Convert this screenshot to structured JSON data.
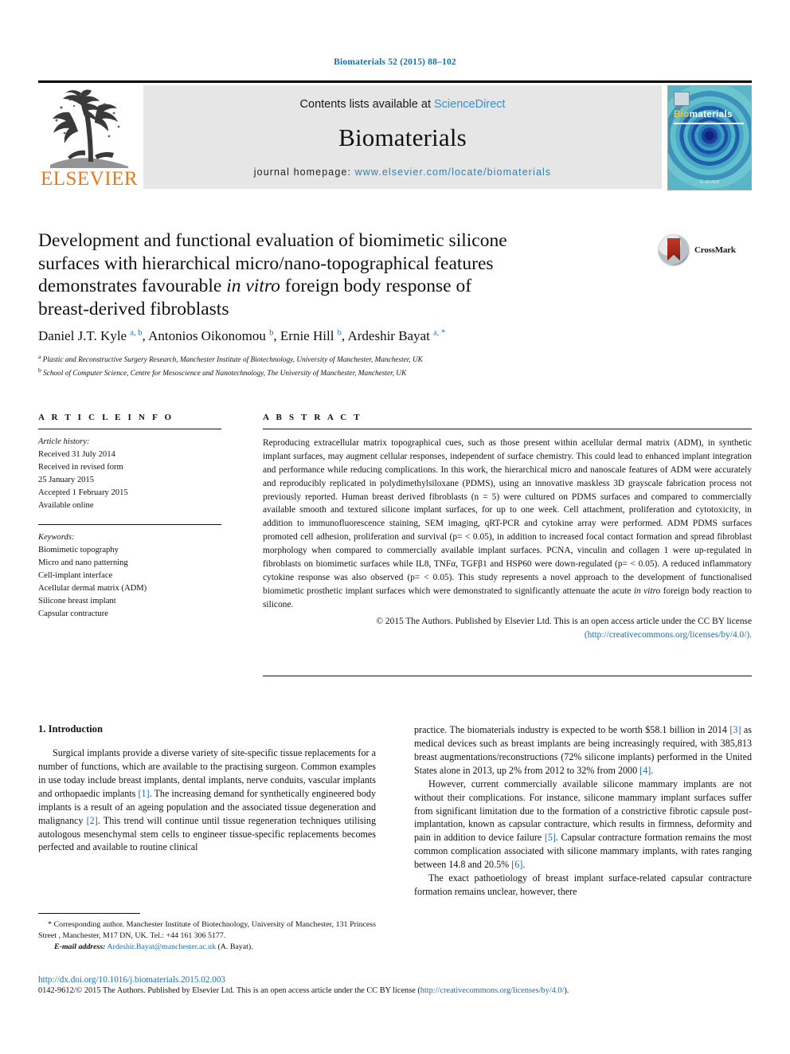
{
  "running_head": "Biomaterials 52 (2015) 88–102",
  "masthead": {
    "publisher_name": "ELSEVIER",
    "contents_prefix": "Contents lists available at ",
    "contents_link": "ScienceDirect",
    "journal_title": "Biomaterials",
    "homepage_prefix": "journal homepage: ",
    "homepage_url": "www.elsevier.com/locate/biomaterials",
    "cover": {
      "title_first": "Bio",
      "title_rest": "materials",
      "footer": "ELSEVIER"
    }
  },
  "article": {
    "title_line1": "Development and functional evaluation of biomimetic silicone",
    "title_line2": "surfaces with hierarchical micro/nano-topographical features",
    "title_line3_pre": "demonstrates favourable ",
    "title_line3_em": "in vitro",
    "title_line3_post": " foreign body response of",
    "title_line4": "breast-derived fibroblasts",
    "crossmark_label": "CrossMark",
    "authors_html": "Daniel J.T. Kyle <sup>a, b</sup>, Antonios Oikonomou <sup>b</sup>, Ernie Hill <sup>b</sup>, Ardeshir Bayat <sup>a, *</sup>",
    "affiliation_a": "Plastic and Reconstructive Surgery Research, Manchester Institute of Biotechnology, University of Manchester, Manchester, UK",
    "affiliation_b": "School of Computer Science, Centre for Mesoscience and Nanotechnology, The University of Manchester, Manchester, UK"
  },
  "article_info": {
    "heading": "A R T I C L E  I N F O",
    "history_label": "Article history:",
    "history": [
      "Received 31 July 2014",
      "Received in revised form",
      "25 January 2015",
      "Accepted 1 February 2015",
      "Available online"
    ],
    "keywords_label": "Keywords:",
    "keywords": [
      "Biomimetic topography",
      "Micro and nano patterning",
      "Cell-implant interface",
      "Acellular dermal matrix (ADM)",
      "Silicone breast implant",
      "Capsular contracture"
    ]
  },
  "abstract": {
    "heading": "A B S T R A C T",
    "body": "Reproducing extracellular matrix topographical cues, such as those present within acellular dermal matrix (ADM), in synthetic implant surfaces, may augment cellular responses, independent of surface chemistry. This could lead to enhanced implant integration and performance while reducing complications. In this work, the hierarchical micro and nanoscale features of ADM were accurately and reproducibly replicated in polydimethylsiloxane (PDMS), using an innovative maskless 3D grayscale fabrication process not previously reported. Human breast derived fibroblasts (n = 5) were cultured on PDMS surfaces and compared to commercially available smooth and textured silicone implant surfaces, for up to one week. Cell attachment, proliferation and cytotoxicity, in addition to immunofluorescence staining, SEM imaging, qRT-PCR and cytokine array were performed. ADM PDMS surfaces promoted cell adhesion, proliferation and survival (p= < 0.05), in addition to increased focal contact formation and spread fibroblast morphology when compared to commercially available implant surfaces. PCNA, vinculin and collagen 1 were up-regulated in fibroblasts on biomimetic surfaces while IL8, TNFα, TGFβ1 and HSP60 were down-regulated (p= < 0.05). A reduced inflammatory cytokine response was also observed (p= < 0.05). This study represents a novel approach to the development of functionalised biomimetic prosthetic implant surfaces which were demonstrated to significantly attenuate the acute ",
    "body_em": "in vitro",
    "body_tail": " foreign body reaction to silicone.",
    "copyright": "© 2015 The Authors. Published by Elsevier Ltd. This is an open access article under the CC BY license",
    "license_url": "(http://creativecommons.org/licenses/by/4.0/)."
  },
  "introduction": {
    "heading": "1.  Introduction",
    "left_p1_a": "Surgical implants provide a diverse variety of site-specific tissue replacements for a number of functions, which are available to the practising surgeon. Common examples in use today include breast implants, dental implants, nerve conduits, vascular implants and orthopaedic implants ",
    "left_p1_ref1": "[1]",
    "left_p1_b": ". The increasing demand for synthetically engineered body implants is a result of an ageing population and the associated tissue degeneration and malignancy ",
    "left_p1_ref2": "[2]",
    "left_p1_c": ". This trend will continue until tissue regeneration techniques utilising autologous mesenchymal stem cells to engineer tissue-specific replacements becomes perfected and available to routine clinical",
    "right_p1_a": "practice. The biomaterials industry is expected to be worth $58.1 billion in 2014 ",
    "right_p1_ref3": "[3]",
    "right_p1_b": " as medical devices such as breast implants are being increasingly required, with 385,813 breast augmentations/reconstructions (72% silicone implants) performed in the United States alone in 2013, up 2% from 2012 to 32% from 2000 ",
    "right_p1_ref4": "[4]",
    "right_p1_c": ".",
    "right_p2_a": "However, current commercially available silicone mammary implants are not without their complications. For instance, silicone mammary implant surfaces suffer from significant limitation due to the formation of a constrictive fibrotic capsule post-implantation, known as capsular contracture, which results in firmness, deformity and pain in addition to device failure ",
    "right_p2_ref5": "[5]",
    "right_p2_b": ". Capsular contracture formation remains the most common complication associated with silicone mammary implants, with rates ranging between 14.8 and 20.5% ",
    "right_p2_ref6": "[6]",
    "right_p2_c": ".",
    "right_p3": "The exact pathoetiology of breast implant surface-related capsular contracture formation remains unclear, however, there"
  },
  "footnote": {
    "corresponding": "* Corresponding author. Manchester Institute of Biotechnology, University of Manchester, 131 Princess Street , Manchester, M17 DN, UK. Tel.: +44 161 306 5177.",
    "email_label": "E-mail address:",
    "email": "Ardeshir.Bayat@manchester.ac.uk",
    "email_suffix": " (A. Bayat)."
  },
  "page_footer": {
    "doi": "http://dx.doi.org/10.1016/j.biomaterials.2015.02.003",
    "issn_line": "0142-9612/© 2015 The Authors. Published by Elsevier Ltd. This is an open access article under the CC BY license (",
    "issn_license_url": "http://creativecommons.org/licenses/by/4.0/",
    "issn_tail": ")."
  },
  "colors": {
    "link_blue": "#1a6ea8",
    "sciencedirect_blue": "#3a8fc4",
    "elsevier_orange": "#e77817",
    "masthead_gray": "#e6e6e6"
  }
}
